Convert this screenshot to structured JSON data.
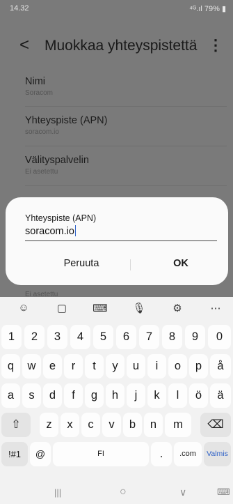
{
  "status_bar": {
    "time": "14.32",
    "right": "⁴ᴳ.ıl 79% ▮"
  },
  "app_bar": {
    "back_glyph": "<",
    "title": "Muokkaa yhteyspistettä",
    "more_glyph": "⋮"
  },
  "settings": [
    {
      "label": "Nimi",
      "value": "Soracom"
    },
    {
      "label": "Yhteyspiste (APN)",
      "value": "soracom.io"
    },
    {
      "label": "Välityspalvelin",
      "value": "Ei asetettu"
    }
  ],
  "behind_value": "Ei asetettu",
  "dialog": {
    "title": "Yhteyspiste (APN)",
    "input_value": "soracom.io",
    "cancel_label": "Peruuta",
    "ok_label": "OK"
  },
  "keyboard": {
    "toolbar": [
      {
        "icon": "emoji-icon",
        "glyph": "☺"
      },
      {
        "icon": "clipboard-icon",
        "glyph": "▢"
      },
      {
        "icon": "keyboard-icon",
        "glyph": "⌨"
      },
      {
        "icon": "microphone-icon",
        "glyph": "🎙"
      },
      {
        "icon": "settings-icon",
        "glyph": "⚙"
      },
      {
        "icon": "more-icon",
        "glyph": "⋯"
      }
    ],
    "number_row": [
      "1",
      "2",
      "3",
      "4",
      "5",
      "6",
      "7",
      "8",
      "9",
      "0"
    ],
    "row1": [
      "q",
      "w",
      "e",
      "r",
      "t",
      "y",
      "u",
      "i",
      "o",
      "p",
      "å"
    ],
    "row2": [
      "a",
      "s",
      "d",
      "f",
      "g",
      "h",
      "j",
      "k",
      "l",
      "ö",
      "ä"
    ],
    "row3": [
      "z",
      "x",
      "c",
      "v",
      "b",
      "n",
      "m"
    ],
    "shift_glyph": "⇧",
    "backspace_glyph": "⌫",
    "symbols_label": "!#1",
    "at_label": "@",
    "space_label": "FI",
    "period_label": ".",
    "com_label": ".com",
    "done_label": "Valmis"
  },
  "nav_bar": {
    "recents": "|||",
    "home": "○",
    "back": "∨",
    "keyboard_switch": "⌨"
  }
}
